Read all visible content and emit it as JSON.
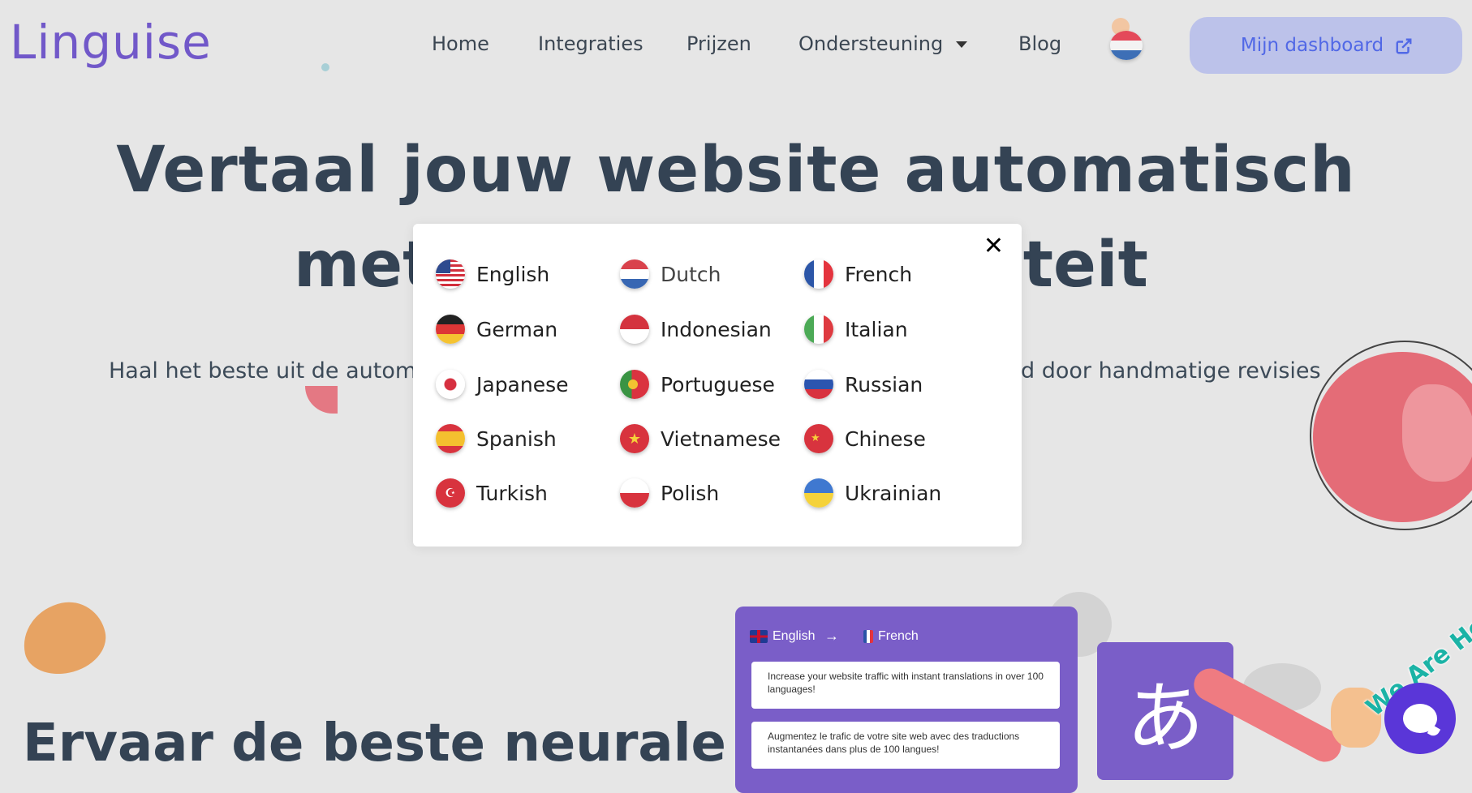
{
  "header": {
    "logo": "Linguise",
    "nav": [
      {
        "label": "Home"
      },
      {
        "label": "Integraties"
      },
      {
        "label": "Prijzen"
      },
      {
        "label": "Ondersteuning"
      },
      {
        "label": "Blog"
      }
    ],
    "dashboard_label": "Mijn dashboard"
  },
  "hero": {
    "line1": "Vertaal jouw website automatisch",
    "line2_left": "met",
    "line2_right": "iteit",
    "sub_left": "Haal het beste uit de autom",
    "sub_right": "d door handmatige revisies"
  },
  "section": {
    "title": "Ervaar de beste neurale"
  },
  "demo": {
    "from_lang": "English",
    "to_lang": "French",
    "arrow": "→",
    "source_text": "Increase your website traffic with instant translations in over 100 languages!",
    "target_text": "Augmentez le trafic de votre site web avec des traductions instantanées dans plus de 100 langues!",
    "glyph": "あ"
  },
  "chat": {
    "badge": "We Are Here!"
  },
  "modal": {
    "close": "✕",
    "languages": [
      {
        "label": "English",
        "flag": "us-flag-icon"
      },
      {
        "label": "Dutch",
        "flag": "nl-flag-icon"
      },
      {
        "label": "French",
        "flag": "fr-flag-icon"
      },
      {
        "label": "German",
        "flag": "de-flag-icon"
      },
      {
        "label": "Indonesian",
        "flag": "id-flag-icon"
      },
      {
        "label": "Italian",
        "flag": "it-flag-icon"
      },
      {
        "label": "Japanese",
        "flag": "jp-flag-icon"
      },
      {
        "label": "Portuguese",
        "flag": "pt-flag-icon"
      },
      {
        "label": "Russian",
        "flag": "ru-flag-icon"
      },
      {
        "label": "Spanish",
        "flag": "es-flag-icon"
      },
      {
        "label": "Vietnamese",
        "flag": "vn-flag-icon"
      },
      {
        "label": "Chinese",
        "flag": "cn-flag-icon"
      },
      {
        "label": "Turkish",
        "flag": "tr-flag-icon"
      },
      {
        "label": "Polish",
        "flag": "pl-flag-icon"
      },
      {
        "label": "Ukrainian",
        "flag": "ua-flag-icon"
      }
    ],
    "current_language": "Dutch"
  },
  "colors": {
    "brand": "#7158c9",
    "dashboard_bg": "#bcc2ea",
    "heading": "#344354",
    "chat": "#5a36d8"
  }
}
